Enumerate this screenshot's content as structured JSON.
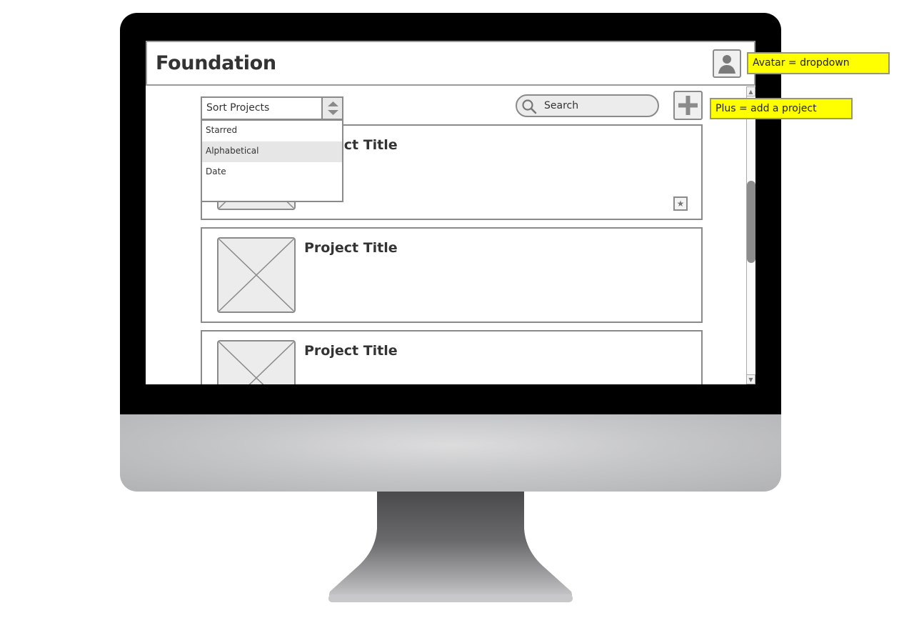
{
  "app": {
    "title": "Foundation"
  },
  "toolbar": {
    "sort_label": "Sort Projects",
    "search_placeholder": "Search"
  },
  "sort_options": [
    "Starred",
    "Alphabetical",
    "Date"
  ],
  "sort_highlighted": "Alphabetical",
  "projects": [
    {
      "title": "Project Title"
    },
    {
      "title": "Project Title"
    },
    {
      "title": "Project Title"
    }
  ],
  "annotations": {
    "avatar_note": "Avatar = dropdown",
    "plus_note": "Plus = add a project"
  },
  "icons": {
    "avatar": "user-silhouette-icon",
    "search": "magnifier-icon",
    "add": "plus-icon",
    "star": "star-icon",
    "sort": "updown-arrows-icon"
  },
  "colors": {
    "note_bg": "#ffff00",
    "bezel": "#000000"
  }
}
